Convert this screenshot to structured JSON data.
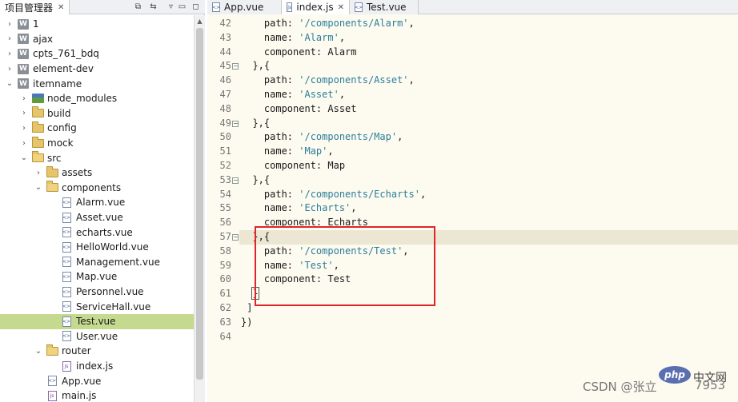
{
  "explorer": {
    "title": "项目管理器",
    "tree": [
      {
        "label": "1",
        "level": 0,
        "icon": "project-icon",
        "expanded": false
      },
      {
        "label": "ajax",
        "level": 0,
        "icon": "project-icon",
        "expanded": false
      },
      {
        "label": "cpts_761_bdq",
        "level": 0,
        "icon": "project-icon",
        "expanded": false
      },
      {
        "label": "element-dev",
        "level": 0,
        "icon": "project-icon",
        "expanded": false
      },
      {
        "label": "itemname",
        "level": 0,
        "icon": "project-icon",
        "expanded": true
      },
      {
        "label": "node_modules",
        "level": 1,
        "icon": "node-modules-folder-icon",
        "expanded": false
      },
      {
        "label": "build",
        "level": 1,
        "icon": "folder-icon",
        "expanded": false
      },
      {
        "label": "config",
        "level": 1,
        "icon": "folder-icon",
        "expanded": false
      },
      {
        "label": "mock",
        "level": 1,
        "icon": "folder-icon",
        "expanded": false
      },
      {
        "label": "src",
        "level": 1,
        "icon": "folder-open-icon",
        "expanded": true
      },
      {
        "label": "assets",
        "level": 2,
        "icon": "folder-icon",
        "expanded": false
      },
      {
        "label": "components",
        "level": 2,
        "icon": "folder-open-icon",
        "expanded": true
      },
      {
        "label": "Alarm.vue",
        "level": 3,
        "icon": "vue-file-icon"
      },
      {
        "label": "Asset.vue",
        "level": 3,
        "icon": "vue-file-icon"
      },
      {
        "label": "echarts.vue",
        "level": 3,
        "icon": "vue-file-icon"
      },
      {
        "label": "HelloWorld.vue",
        "level": 3,
        "icon": "vue-file-icon"
      },
      {
        "label": "Management.vue",
        "level": 3,
        "icon": "vue-file-icon"
      },
      {
        "label": "Map.vue",
        "level": 3,
        "icon": "vue-file-icon"
      },
      {
        "label": "Personnel.vue",
        "level": 3,
        "icon": "vue-file-icon"
      },
      {
        "label": "ServiceHall.vue",
        "level": 3,
        "icon": "vue-file-icon"
      },
      {
        "label": "Test.vue",
        "level": 3,
        "icon": "vue-file-icon",
        "selected": true
      },
      {
        "label": "User.vue",
        "level": 3,
        "icon": "vue-file-icon"
      },
      {
        "label": "router",
        "level": 2,
        "icon": "folder-open-icon",
        "expanded": true
      },
      {
        "label": "index.js",
        "level": 3,
        "icon": "js-file-icon"
      },
      {
        "label": "App.vue",
        "level": 2,
        "icon": "vue-file-icon"
      },
      {
        "label": "main.js",
        "level": 2,
        "icon": "js-file-icon"
      }
    ]
  },
  "editor": {
    "tabs": [
      {
        "label": "App.vue",
        "icon": "vue-file-icon",
        "active": false
      },
      {
        "label": "index.js",
        "icon": "js-file-icon",
        "active": true
      },
      {
        "label": "Test.vue",
        "icon": "vue-file-icon",
        "active": false
      }
    ],
    "lines": [
      {
        "n": "42",
        "fold": false,
        "parts": [
          [
            "    path: ",
            ""
          ],
          [
            "'/components/Alarm'",
            "str"
          ],
          [
            ",",
            ""
          ]
        ]
      },
      {
        "n": "43",
        "fold": false,
        "parts": [
          [
            "    name: ",
            ""
          ],
          [
            "'Alarm'",
            "str"
          ],
          [
            ",",
            ""
          ]
        ]
      },
      {
        "n": "44",
        "fold": false,
        "parts": [
          [
            "    component: Alarm",
            ""
          ]
        ]
      },
      {
        "n": "45",
        "fold": true,
        "parts": [
          [
            "  },{",
            ""
          ]
        ]
      },
      {
        "n": "46",
        "fold": false,
        "parts": [
          [
            "    path: ",
            ""
          ],
          [
            "'/components/Asset'",
            "str"
          ],
          [
            ",",
            ""
          ]
        ]
      },
      {
        "n": "47",
        "fold": false,
        "parts": [
          [
            "    name: ",
            ""
          ],
          [
            "'Asset'",
            "str"
          ],
          [
            ",",
            ""
          ]
        ]
      },
      {
        "n": "48",
        "fold": false,
        "parts": [
          [
            "    component: Asset",
            ""
          ]
        ]
      },
      {
        "n": "49",
        "fold": true,
        "parts": [
          [
            "  },{",
            ""
          ]
        ]
      },
      {
        "n": "50",
        "fold": false,
        "parts": [
          [
            "    path: ",
            ""
          ],
          [
            "'/components/Map'",
            "str"
          ],
          [
            ",",
            ""
          ]
        ]
      },
      {
        "n": "51",
        "fold": false,
        "parts": [
          [
            "    name: ",
            ""
          ],
          [
            "'Map'",
            "str"
          ],
          [
            ",",
            ""
          ]
        ]
      },
      {
        "n": "52",
        "fold": false,
        "parts": [
          [
            "    component: Map",
            ""
          ]
        ]
      },
      {
        "n": "53",
        "fold": true,
        "parts": [
          [
            "  },{",
            ""
          ]
        ]
      },
      {
        "n": "54",
        "fold": false,
        "parts": [
          [
            "    path: ",
            ""
          ],
          [
            "'/components/Echarts'",
            "str"
          ],
          [
            ",",
            ""
          ]
        ]
      },
      {
        "n": "55",
        "fold": false,
        "parts": [
          [
            "    name: ",
            ""
          ],
          [
            "'Echarts'",
            "str"
          ],
          [
            ",",
            ""
          ]
        ]
      },
      {
        "n": "56",
        "fold": false,
        "parts": [
          [
            "    component: Echarts",
            ""
          ]
        ]
      },
      {
        "n": "57",
        "fold": true,
        "highlight": true,
        "parts": [
          [
            "  },{",
            ""
          ]
        ]
      },
      {
        "n": "58",
        "fold": false,
        "parts": [
          [
            "    path: ",
            ""
          ],
          [
            "'/components/Test'",
            "str"
          ],
          [
            ",",
            ""
          ]
        ]
      },
      {
        "n": "59",
        "fold": false,
        "parts": [
          [
            "    name: ",
            ""
          ],
          [
            "'Test'",
            "str"
          ],
          [
            ",",
            ""
          ]
        ]
      },
      {
        "n": "60",
        "fold": false,
        "parts": [
          [
            "    component: Test",
            ""
          ]
        ]
      },
      {
        "n": "61",
        "fold": false,
        "parts": [
          [
            "  ",
            ""
          ],
          [
            "}",
            "cur"
          ]
        ]
      },
      {
        "n": "62",
        "fold": false,
        "parts": [
          [
            " ]",
            ""
          ]
        ]
      },
      {
        "n": "63",
        "fold": false,
        "parts": [
          [
            "})",
            ""
          ]
        ]
      },
      {
        "n": "64",
        "fold": false,
        "parts": [
          [
            "",
            ""
          ]
        ]
      }
    ]
  },
  "watermark": {
    "csdn": "CSDN @张立",
    "logo": "php",
    "site": "中文网",
    "num": "7953"
  }
}
